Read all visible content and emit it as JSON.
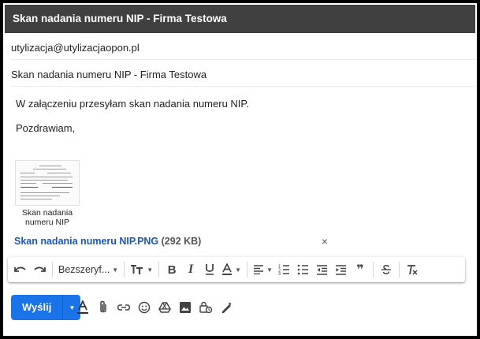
{
  "window": {
    "title": "Skan nadania numeru NIP - Firma Testowa"
  },
  "recipients": {
    "to": "utylizacja@utylizacjaopon.pl"
  },
  "subject": {
    "value": "Skan nadania numeru NIP - Firma Testowa"
  },
  "body": {
    "line1": "W załączeniu przesyłam skan nadania numeru NIP.",
    "line2": "Pozdrawiam,"
  },
  "attachment": {
    "thumbnail_caption": "Skan nadania numeru NIP",
    "file_name": "Skan nadania numeru NIP.PNG",
    "file_size": "(292 KB)",
    "close_symbol": "×"
  },
  "formatting_toolbar": {
    "font_name": "Bezszeryf...",
    "items": [
      "undo-icon",
      "redo-icon",
      "font-family-select",
      "font-size-icon",
      "bold-icon",
      "italic-icon",
      "underline-icon",
      "text-color-icon",
      "align-icon",
      "numbered-list-icon",
      "bulleted-list-icon",
      "indent-less-icon",
      "indent-more-icon",
      "quote-icon",
      "strikethrough-icon",
      "remove-formatting-icon"
    ]
  },
  "bottom_toolbar": {
    "send_label": "Wyślij",
    "items": [
      "formatting-options-icon",
      "attach-file-icon",
      "insert-link-icon",
      "insert-emoji-icon",
      "google-drive-icon",
      "insert-photo-icon",
      "confidential-mode-icon",
      "signature-icon"
    ]
  },
  "colors": {
    "header_bg": "#404040",
    "send_button": "#1a73e8",
    "attachment_link": "#1a56c2"
  }
}
